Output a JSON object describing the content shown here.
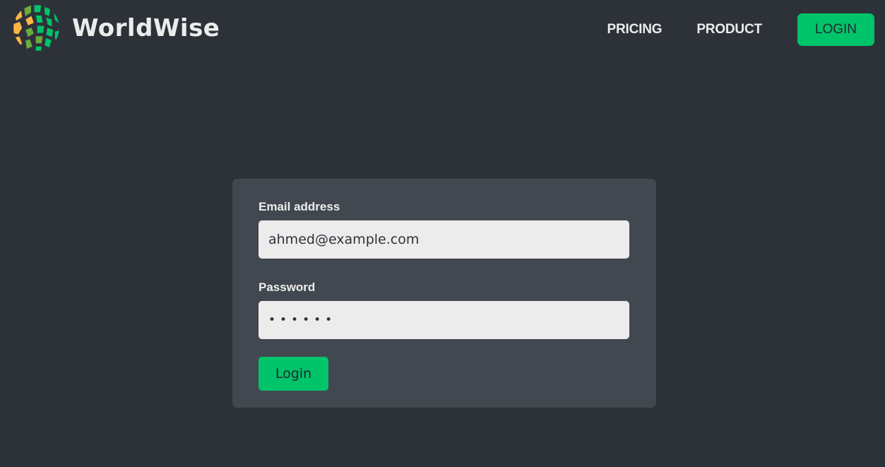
{
  "nav": {
    "brand": "WorldWise",
    "links": [
      {
        "label": "PRICING"
      },
      {
        "label": "PRODUCT"
      }
    ],
    "cta_label": "LOGIN"
  },
  "form": {
    "email": {
      "label": "Email address",
      "value": "ahmed@example.com"
    },
    "password": {
      "label": "Password",
      "value": "••••••"
    },
    "submit_label": "Login"
  },
  "colors": {
    "background": "#2d3239",
    "card": "#42484f",
    "accent": "#00c46a",
    "input_bg": "#ececec",
    "text": "#ececec",
    "logo_orange": "#ffb545",
    "logo_green": "#00c46a",
    "logo_lime": "#6aab3c"
  },
  "icons": {
    "brand_logo": "globe-logo-icon"
  }
}
